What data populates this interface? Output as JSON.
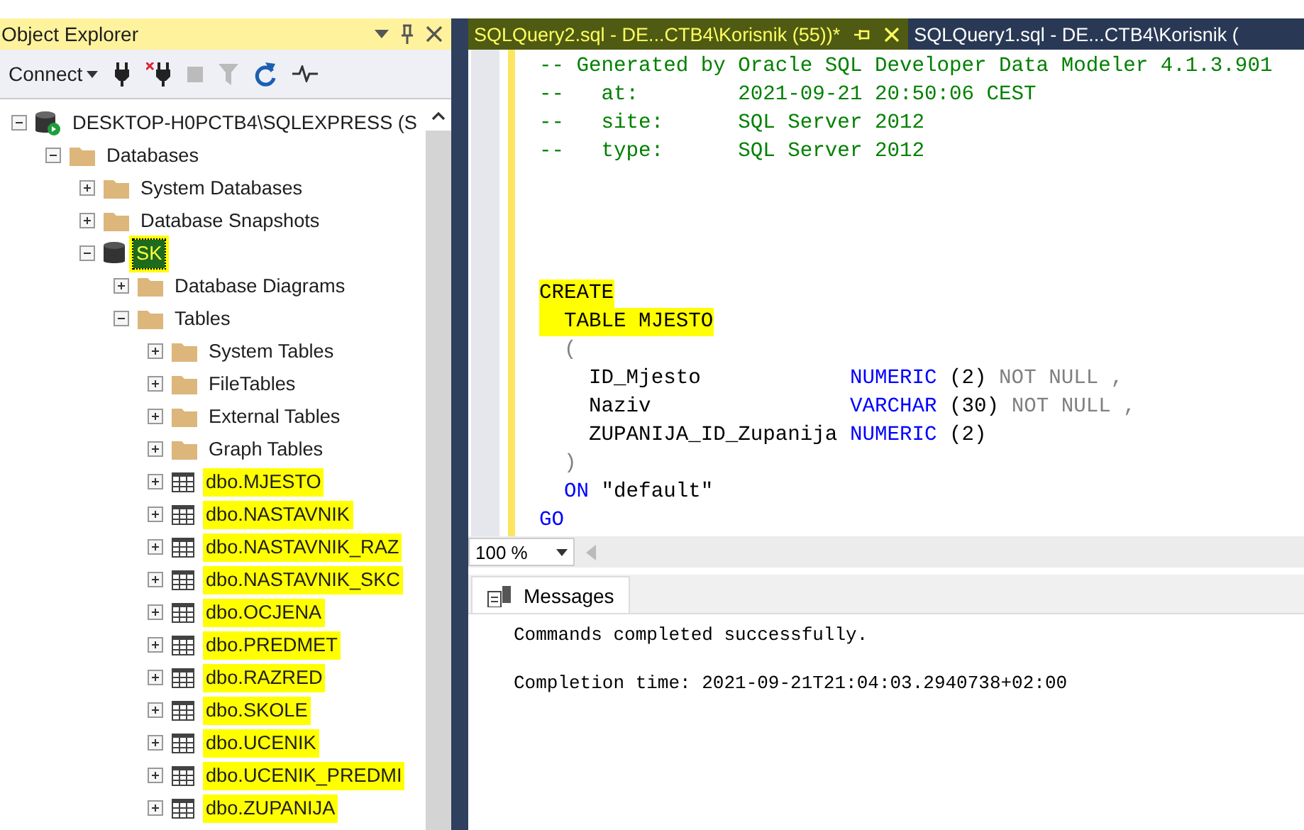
{
  "object_explorer": {
    "title": "Object Explorer",
    "toolbar": {
      "connect": "Connect"
    },
    "tree": [
      {
        "label": "DESKTOP-H0PCTB4\\SQLEXPRESS (S",
        "kind": "server",
        "expanded": true,
        "highlighted": false,
        "selected": false,
        "children": [
          {
            "label": "Databases",
            "kind": "folder",
            "expanded": true,
            "highlighted": false,
            "selected": false,
            "children": [
              {
                "label": "System Databases",
                "kind": "folder",
                "expanded": false,
                "highlighted": false,
                "selected": false
              },
              {
                "label": "Database Snapshots",
                "kind": "folder",
                "expanded": false,
                "highlighted": false,
                "selected": false
              },
              {
                "label": "SK",
                "kind": "database",
                "expanded": true,
                "highlighted": true,
                "selected": true,
                "children": [
                  {
                    "label": "Database Diagrams",
                    "kind": "folder",
                    "expanded": false,
                    "highlighted": false,
                    "selected": false
                  },
                  {
                    "label": "Tables",
                    "kind": "folder",
                    "expanded": true,
                    "highlighted": false,
                    "selected": false,
                    "children": [
                      {
                        "label": "System Tables",
                        "kind": "folder",
                        "expanded": false,
                        "highlighted": false,
                        "selected": false
                      },
                      {
                        "label": "FileTables",
                        "kind": "folder",
                        "expanded": false,
                        "highlighted": false,
                        "selected": false
                      },
                      {
                        "label": "External Tables",
                        "kind": "folder",
                        "expanded": false,
                        "highlighted": false,
                        "selected": false
                      },
                      {
                        "label": "Graph Tables",
                        "kind": "folder",
                        "expanded": false,
                        "highlighted": false,
                        "selected": false
                      },
                      {
                        "label": "dbo.MJESTO",
                        "kind": "table",
                        "expanded": false,
                        "highlighted": true,
                        "selected": false
                      },
                      {
                        "label": "dbo.NASTAVNIK",
                        "kind": "table",
                        "expanded": false,
                        "highlighted": true,
                        "selected": false
                      },
                      {
                        "label": "dbo.NASTAVNIK_RAZ",
                        "kind": "table",
                        "expanded": false,
                        "highlighted": true,
                        "selected": false
                      },
                      {
                        "label": "dbo.NASTAVNIK_SKC",
                        "kind": "table",
                        "expanded": false,
                        "highlighted": true,
                        "selected": false
                      },
                      {
                        "label": "dbo.OCJENA",
                        "kind": "table",
                        "expanded": false,
                        "highlighted": true,
                        "selected": false
                      },
                      {
                        "label": "dbo.PREDMET",
                        "kind": "table",
                        "expanded": false,
                        "highlighted": true,
                        "selected": false
                      },
                      {
                        "label": "dbo.RAZRED",
                        "kind": "table",
                        "expanded": false,
                        "highlighted": true,
                        "selected": false
                      },
                      {
                        "label": "dbo.SKOLE",
                        "kind": "table",
                        "expanded": false,
                        "highlighted": true,
                        "selected": false
                      },
                      {
                        "label": "dbo.UCENIK",
                        "kind": "table",
                        "expanded": false,
                        "highlighted": true,
                        "selected": false
                      },
                      {
                        "label": "dbo.UCENIK_PREDMI",
                        "kind": "table",
                        "expanded": false,
                        "highlighted": true,
                        "selected": false
                      },
                      {
                        "label": "dbo.ZUPANIJA",
                        "kind": "table",
                        "expanded": false,
                        "highlighted": true,
                        "selected": false
                      }
                    ]
                  }
                ]
              }
            ]
          }
        ]
      }
    ]
  },
  "editor": {
    "tabs": [
      {
        "label": "SQLQuery2.sql - DE...CTB4\\Korisnik (55))*",
        "selected": true,
        "highlighted": true
      },
      {
        "label": "SQLQuery1.sql - DE...CTB4\\Korisnik (",
        "selected": false,
        "highlighted": false
      }
    ],
    "lines": [
      {
        "kind": "code",
        "highlighted": false,
        "segments": [
          {
            "text": "-- Generated by Oracle SQL Developer Data Modeler 4.1.3.901",
            "kind": "comment"
          }
        ]
      },
      {
        "kind": "code",
        "highlighted": false,
        "segments": [
          {
            "text": "--   at:        2021-09-21 20:50:06 CEST",
            "kind": "comment"
          }
        ]
      },
      {
        "kind": "code",
        "highlighted": false,
        "segments": [
          {
            "text": "--   site:      SQL Server 2012",
            "kind": "comment"
          }
        ]
      },
      {
        "kind": "code",
        "highlighted": false,
        "segments": [
          {
            "text": "--   type:      SQL Server 2012",
            "kind": "comment"
          }
        ]
      },
      {
        "kind": "blank"
      },
      {
        "kind": "blank"
      },
      {
        "kind": "blank"
      },
      {
        "kind": "blank"
      },
      {
        "kind": "code",
        "highlighted": true,
        "segments": [
          {
            "text": "CREATE",
            "kind": "plain"
          }
        ]
      },
      {
        "kind": "code",
        "highlighted": true,
        "segments": [
          {
            "text": "  TABLE MJESTO",
            "kind": "plain"
          }
        ]
      },
      {
        "kind": "code",
        "highlighted": false,
        "segments": [
          {
            "text": "  (",
            "kind": "gray"
          }
        ]
      },
      {
        "kind": "code",
        "highlighted": false,
        "segments": [
          {
            "text": "    ID_Mjesto            ",
            "kind": "plain"
          },
          {
            "text": "NUMERIC",
            "kind": "keyword"
          },
          {
            "text": " (2)",
            "kind": "plain"
          },
          {
            "text": " NOT NULL ,",
            "kind": "gray"
          }
        ]
      },
      {
        "kind": "code",
        "highlighted": false,
        "segments": [
          {
            "text": "    Naziv                ",
            "kind": "plain"
          },
          {
            "text": "VARCHAR",
            "kind": "keyword"
          },
          {
            "text": " (30)",
            "kind": "plain"
          },
          {
            "text": " NOT NULL ,",
            "kind": "gray"
          }
        ]
      },
      {
        "kind": "code",
        "highlighted": false,
        "segments": [
          {
            "text": "    ZUPANIJA_ID_Zupanija ",
            "kind": "plain"
          },
          {
            "text": "NUMERIC",
            "kind": "keyword"
          },
          {
            "text": " (2)",
            "kind": "plain"
          }
        ]
      },
      {
        "kind": "code",
        "highlighted": false,
        "segments": [
          {
            "text": "  )",
            "kind": "gray"
          }
        ]
      },
      {
        "kind": "code",
        "highlighted": false,
        "segments": [
          {
            "text": "  ON",
            "kind": "keyword"
          },
          {
            "text": " \"default\"",
            "kind": "plain"
          }
        ]
      },
      {
        "kind": "code",
        "highlighted": false,
        "segments": [
          {
            "text": "GO",
            "kind": "keyword"
          }
        ]
      }
    ],
    "zoom": "100 %",
    "results": {
      "tab": "Messages",
      "messages": [
        "Commands completed successfully.",
        "Completion time: 2021-09-21T21:04:03.2940738+02:00"
      ]
    }
  }
}
